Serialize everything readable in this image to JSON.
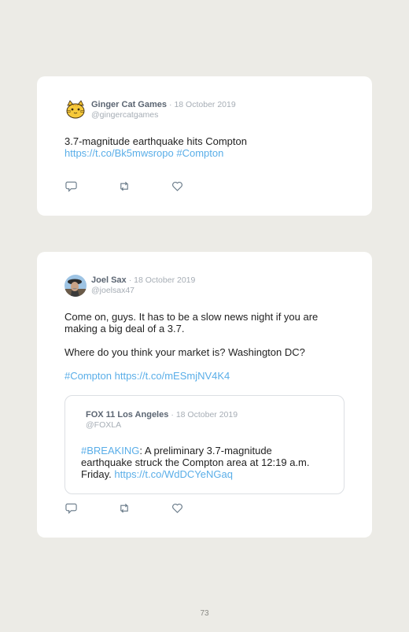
{
  "tweets": [
    {
      "name": "Ginger Cat Games",
      "date": "· 18 October 2019",
      "handle": "@gingercatgames",
      "text_line1": "3.7-magnitude earthquake hits Compton",
      "link": "https://t.co/Bk5mwsropo",
      "hashtag": "#Compton"
    },
    {
      "name": "Joel Sax",
      "date": "· 18 October 2019",
      "handle": "@joelsax47",
      "p1_line1": "Come on, guys. It has to be a slow news night if you are",
      "p1_line2": "making a big deal of a 3.7.",
      "p2": "Where do you think your market is? Washington DC?",
      "hashtag": "#Compton",
      "link": "https://t.co/mESmjNV4K4",
      "quoted": {
        "name": "FOX 11 Los Angeles",
        "date": "· 18 October 2019",
        "handle": "@FOXLA",
        "hashtag": "#BREAKING",
        "line1_rest": ": A preliminary 3.7-magnitude",
        "line2": "earthquake struck the Compton area at 12:19 a.m.",
        "line3_start": "Friday.",
        "link": "https://t.co/WdDCYeNGaq"
      }
    }
  ],
  "icons": {
    "reply": "reply-icon",
    "retweet": "retweet-icon",
    "like": "like-icon"
  },
  "colors": {
    "link": "#5aaee8",
    "name": "#5b6572",
    "meta": "#a6adb5"
  },
  "page_number": "73"
}
